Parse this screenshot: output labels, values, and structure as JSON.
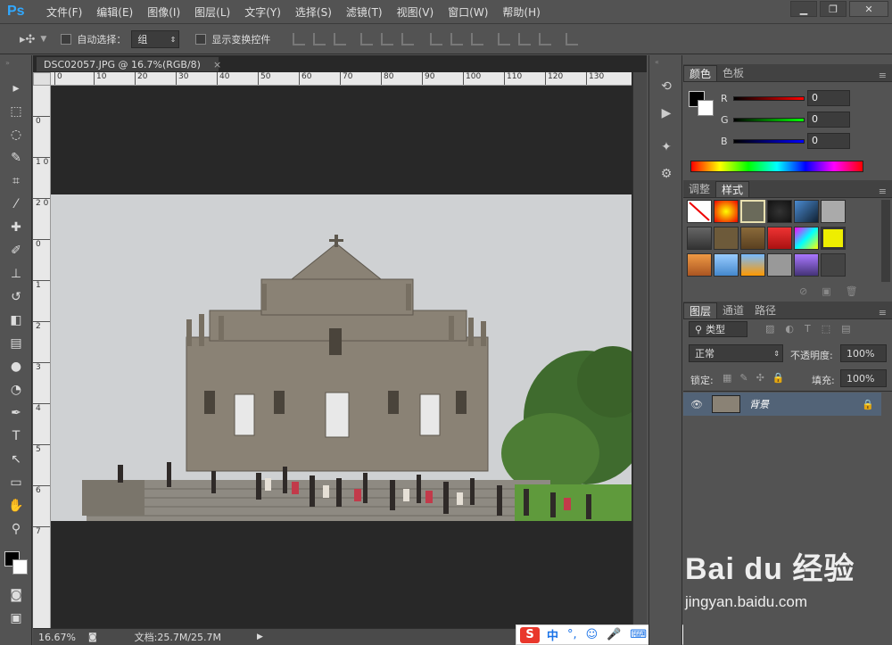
{
  "app": {
    "logo": "Ps"
  },
  "menu": [
    "文件(F)",
    "编辑(E)",
    "图像(I)",
    "图层(L)",
    "文字(Y)",
    "选择(S)",
    "滤镜(T)",
    "视图(V)",
    "窗口(W)",
    "帮助(H)"
  ],
  "window_buttons": {
    "minimize": "▁",
    "restore": "❐",
    "close": "✕"
  },
  "options": {
    "auto_select_label": "自动选择：",
    "auto_select_value": "组",
    "show_transform_label": "显示变换控件"
  },
  "document": {
    "tab_title": "DSC02057.JPG @ 16.7%(RGB/8)",
    "close": "×"
  },
  "ruler_top": [
    "0",
    "10",
    "20",
    "30",
    "40",
    "50",
    "60",
    "70",
    "80",
    "90",
    "100",
    "110",
    "120",
    "130"
  ],
  "ruler_left": [
    "0",
    "1 0",
    "2 0",
    "0",
    "1",
    "2",
    "3",
    "4",
    "5",
    "6",
    "7"
  ],
  "status": {
    "zoom": "16.67%",
    "doc_info": "文档:25.7M/25.7M"
  },
  "ime": {
    "label": "中",
    "icons": [
      "°,",
      "☺",
      "🎤",
      "⌨"
    ]
  },
  "color_panel": {
    "tabs": [
      "颜色",
      "色板"
    ],
    "r_label": "R",
    "g_label": "G",
    "b_label": "B",
    "r": "0",
    "g": "0",
    "b": "0"
  },
  "styles_panel": {
    "tabs": [
      "调整",
      "样式"
    ]
  },
  "layers_panel": {
    "tabs": [
      "图层",
      "通道",
      "路径"
    ],
    "filter_kind": "类型",
    "blend_mode": "正常",
    "opacity_label": "不透明度:",
    "opacity": "100%",
    "lock_label": "锁定:",
    "fill_label": "填充:",
    "fill": "100%",
    "layer_name": "背景"
  },
  "watermark": {
    "brand": "Bai du 经验",
    "url": "jingyan.baidu.com"
  },
  "colors": {
    "ps_blue": "#31a8ff",
    "panel_bg": "#535353",
    "canvas_bg": "#282828",
    "layer_selected": "#526377"
  }
}
